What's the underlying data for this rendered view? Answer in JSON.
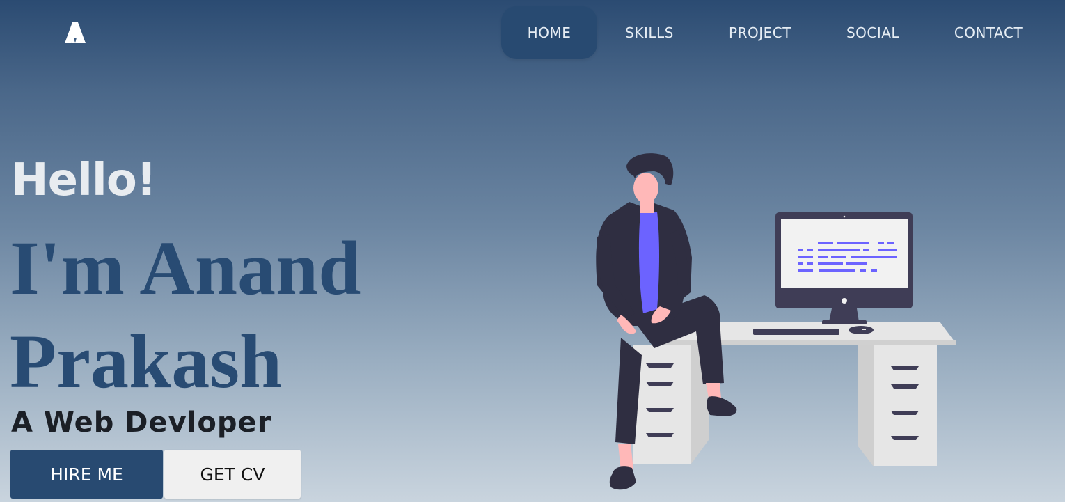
{
  "brand": {
    "logo_icon": "triangle-logo-icon"
  },
  "nav": {
    "items": [
      {
        "label": "HOME",
        "active": true
      },
      {
        "label": "SKILLS",
        "active": false
      },
      {
        "label": "PROJECT",
        "active": false
      },
      {
        "label": "SOCIAL",
        "active": false
      },
      {
        "label": "CONTACT",
        "active": false
      }
    ]
  },
  "hero": {
    "greeting": "Hello!",
    "name_line1": "I'm Anand",
    "name_line2": "Prakash",
    "role": "A Web Devloper",
    "hire_label": "HIRE ME",
    "cv_label": "GET CV"
  },
  "illustration": {
    "icon": "developer-at-desk-illustration"
  },
  "colors": {
    "accent": "#284a71",
    "name_text": "#284b73",
    "code_lines": "#6c63ff",
    "shirt": "#6c63ff",
    "outfit": "#2f2e41",
    "skin": "#ffb8b8",
    "desk": "#e6e6e6"
  }
}
